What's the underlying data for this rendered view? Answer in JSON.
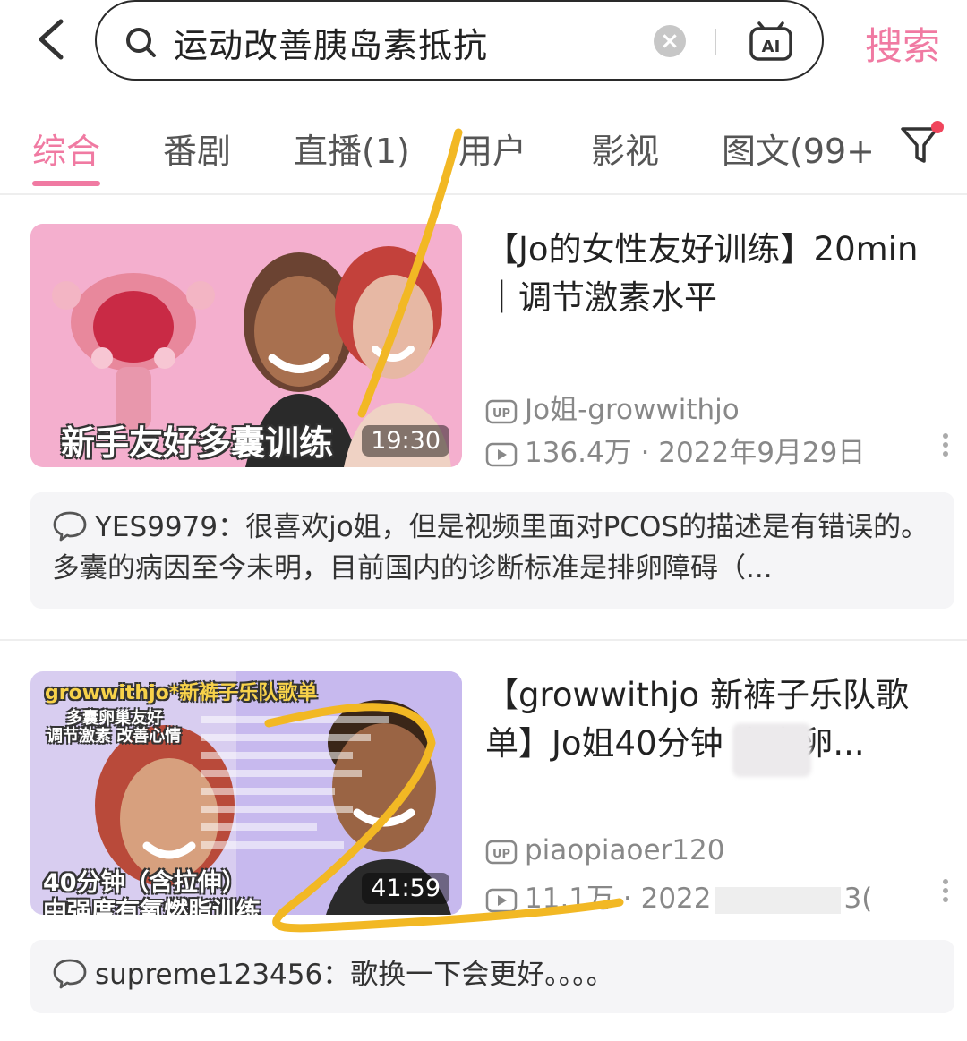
{
  "search": {
    "query": "运动改善胰岛素抵抗",
    "submit_label": "搜索",
    "ai_label": "AI"
  },
  "tabs": [
    {
      "label": "综合",
      "active": true
    },
    {
      "label": "番剧",
      "active": false
    },
    {
      "label": "直播(1)",
      "active": false
    },
    {
      "label": "用户",
      "active": false
    },
    {
      "label": "影视",
      "active": false
    },
    {
      "label": "图文(99+",
      "active": false
    }
  ],
  "colors": {
    "accent": "#f07aa2",
    "highlight_stroke": "#f2b824"
  },
  "results": [
    {
      "title": "【Jo的女性友好训练】20min｜调节激素水平",
      "thumb_caption": "新手友好多囊训练",
      "duration": "19:30",
      "uploader": "Jo姐-growwithjo",
      "stats": "136.4万 · 2022年9月29日",
      "comment_user": "YES9979：",
      "comment_text": "很喜欢jo姐，但是视频里面对PCOS的描述是有错误的。 多囊的病因至今未明，目前国内的诊断标准是排卵障碍（..."
    },
    {
      "title": "【growwithjo 新裤子乐队歌单】Jo姐40分钟    多囊卵...",
      "thumb_caption_top": "growwithjo*新裤子乐队歌单",
      "thumb_caption_sub1": "多囊卵巢友好",
      "thumb_caption_sub2": "调节激素 改善心情",
      "thumb_caption_line1": "40分钟（含拉伸）",
      "thumb_caption_line2": "中强度有氧燃脂训练",
      "duration": "41:59",
      "uploader": "piaopiaoer120",
      "stats_views": "11.1万",
      "stats_date": "· 2022",
      "stats_date_tail": "3(",
      "comment_user": "supreme123456：",
      "comment_text": "歌换一下会更好。。。。"
    }
  ]
}
